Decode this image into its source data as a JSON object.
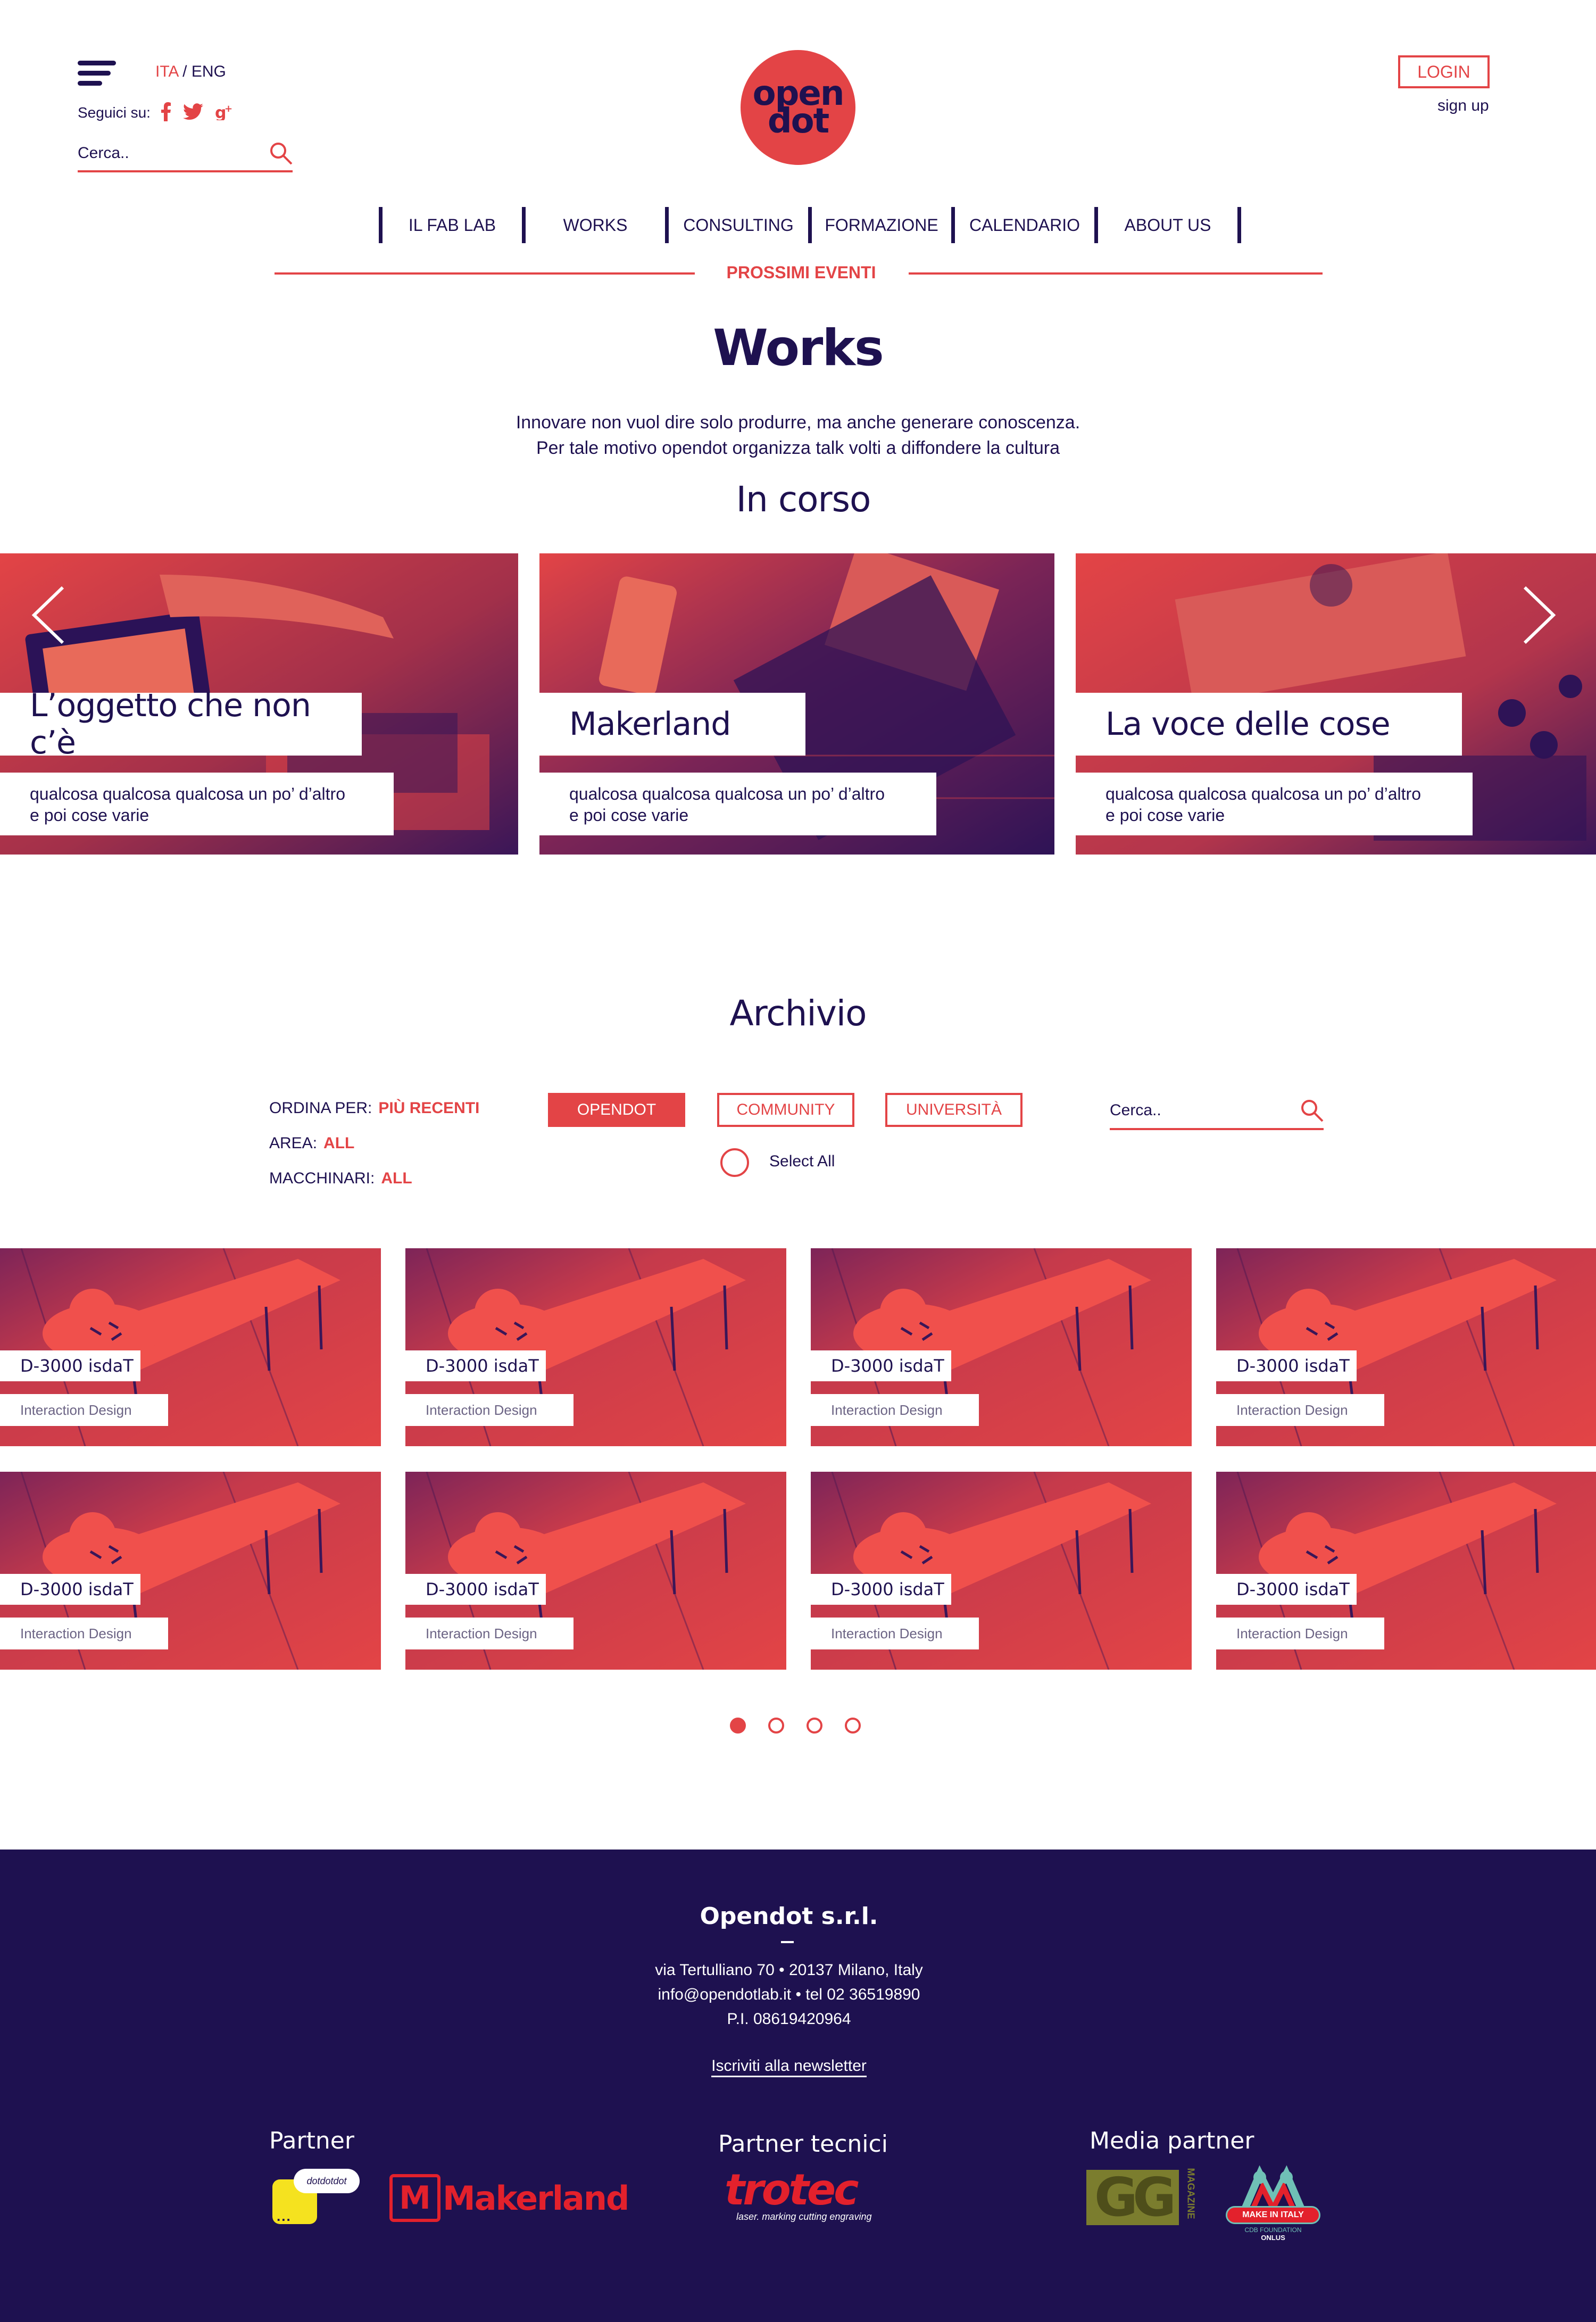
{
  "header": {
    "lang_active": "ITA",
    "lang_sep": " / ",
    "lang_other": "ENG",
    "follow_label": "Seguici su:",
    "social_icons": [
      "facebook-icon",
      "twitter-icon",
      "google-plus-icon"
    ],
    "search_placeholder": "Cerca..",
    "logo_line1": "open",
    "logo_line2": "dot",
    "login_label": "LOGIN",
    "signup_label": "sign up"
  },
  "nav": {
    "items": [
      "IL FAB LAB",
      "WORKS",
      "CONSULTING",
      "FORMAZIONE",
      "CALENDARIO",
      "ABOUT US"
    ],
    "events_label": "PROSSIMI EVENTI"
  },
  "page": {
    "title": "Works",
    "intro_line1": "Innovare non vuol dire solo produrre, ma anche generare conoscenza.",
    "intro_line2": "Per tale motivo opendot organizza talk volti a diffondere la cultura"
  },
  "in_corso": {
    "heading": "In corso",
    "cards": [
      {
        "title": "L’oggetto che non c’è",
        "desc1": "qualcosa qualcosa qualcosa un po’ d’altro",
        "desc2": "e poi cose varie"
      },
      {
        "title": "Makerland",
        "desc1": "qualcosa qualcosa qualcosa un po’ d’altro",
        "desc2": "e poi cose varie"
      },
      {
        "title": "La voce delle cose",
        "desc1": "qualcosa qualcosa qualcosa un po’ d’altro",
        "desc2": "e poi cose varie"
      }
    ]
  },
  "archivio": {
    "heading": "Archivio",
    "sort_label": "ORDINA PER:",
    "sort_value": "PIÙ RECENTI",
    "area_label": "AREA:",
    "area_value": "ALL",
    "machines_label": "MACCHINARI:",
    "machines_value": "ALL",
    "filters": [
      "OPENDOT",
      "COMMUNITY",
      "UNIVERSITÀ"
    ],
    "select_all": "Select All",
    "search_placeholder": "Cerca..",
    "cards": [
      {
        "title": "D-3000 isdaT",
        "tag": "Interaction Design"
      },
      {
        "title": "D-3000 isdaT",
        "tag": "Interaction Design"
      },
      {
        "title": "D-3000 isdaT",
        "tag": "Interaction Design"
      },
      {
        "title": "D-3000 isdaT",
        "tag": "Interaction Design"
      },
      {
        "title": "D-3000 isdaT",
        "tag": "Interaction Design"
      },
      {
        "title": "D-3000 isdaT",
        "tag": "Interaction Design"
      },
      {
        "title": "D-3000 isdaT",
        "tag": "Interaction Design"
      },
      {
        "title": "D-3000 isdaT",
        "tag": "Interaction Design"
      }
    ],
    "pagination_current": 1,
    "pagination_total": 4
  },
  "footer": {
    "company": "Opendot s.r.l.",
    "address": "via Tertulliano 70 • 20137 Milano, Italy",
    "contact": "info@opendotlab.it • tel 02 36519890",
    "vat": "P.I. 08619420964",
    "newsletter": "Iscriviti alla newsletter",
    "partner_heading": "Partner",
    "tech_heading": "Partner tecnici",
    "media_heading": "Media partner",
    "logo_dotdotdot": "dotdotdot",
    "logo_makerland": "Makerland",
    "logo_trotec": "trotec",
    "logo_trotec_tagline": "laser. marking cutting engraving",
    "logo_gg": "GG",
    "logo_gg_side": "MAGAZINE",
    "logo_mii": "MAKE IN ITALY",
    "logo_mii_sub1": "CDB FOUNDATION",
    "logo_mii_sub2": "ONLUS"
  },
  "colors": {
    "navy": "#1e1150",
    "red": "#e34446"
  }
}
